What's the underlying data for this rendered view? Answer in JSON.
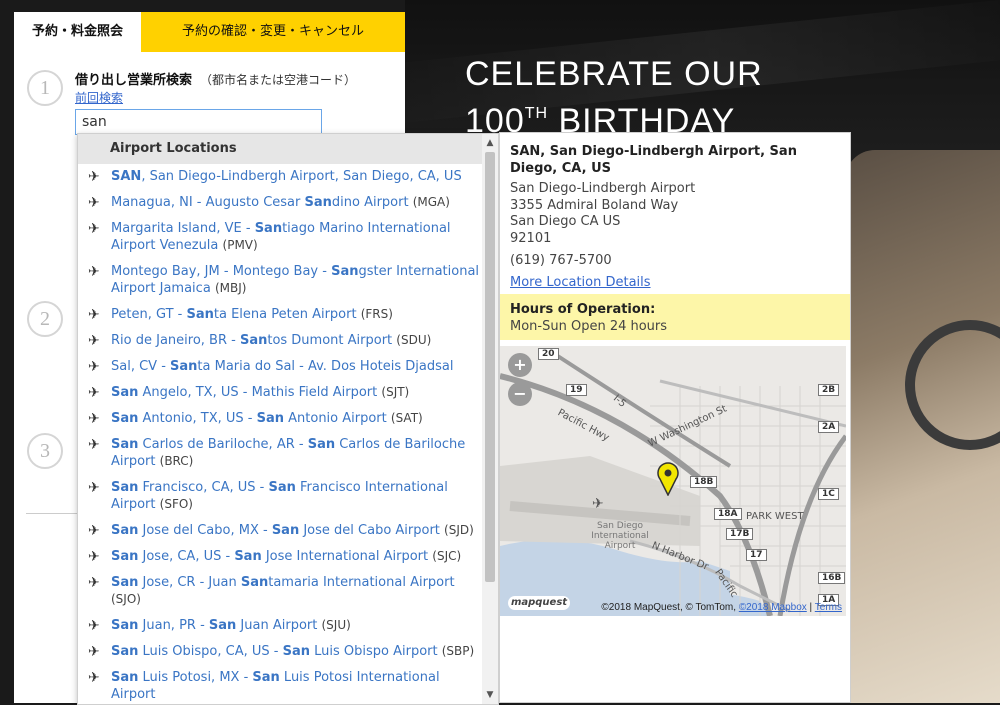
{
  "hero": {
    "line1": "CELEBRATE OUR",
    "line2_num": "100",
    "line2_sup": "TH",
    "line2_rest": " BIRTHDAY"
  },
  "tabs": {
    "active": "予約・料金照会",
    "inactive": "予約の確認・変更・キャンセル"
  },
  "steps": [
    "1",
    "2",
    "3"
  ],
  "pickup": {
    "label": "借り出し営業所検索",
    "hint": "（都市名または空港コード）",
    "prev_link": "前回検索",
    "input_value": "san"
  },
  "dropdown": {
    "header": "Airport Locations",
    "items": [
      {
        "pre": "",
        "hl1": "SAN",
        "mid": ", San Diego-Lindbergh Airport, San Diego, CA, US",
        "hl2": "",
        "post": "",
        "code": ""
      },
      {
        "pre": "Managua, NI - Augusto Cesar ",
        "hl1": "San",
        "mid": "dino Airport",
        "hl2": "",
        "post": "",
        "code": "(MGA)"
      },
      {
        "pre": "Margarita Island, VE - ",
        "hl1": "San",
        "mid": "tiago Marino International Airport Venezula",
        "hl2": "",
        "post": "",
        "code": "(PMV)"
      },
      {
        "pre": "Montego Bay, JM - Montego Bay - ",
        "hl1": "San",
        "mid": "gster International Airport Jamaica",
        "hl2": "",
        "post": "",
        "code": "(MBJ)"
      },
      {
        "pre": "Peten, GT - ",
        "hl1": "San",
        "mid": "ta Elena Peten Airport",
        "hl2": "",
        "post": "",
        "code": "(FRS)"
      },
      {
        "pre": "Rio de Janeiro, BR - ",
        "hl1": "San",
        "mid": "tos Dumont Airport",
        "hl2": "",
        "post": "",
        "code": "(SDU)"
      },
      {
        "pre": "Sal, CV - ",
        "hl1": "San",
        "mid": "ta Maria do Sal - Av. Dos Hoteis Djadsal",
        "hl2": "",
        "post": "",
        "code": ""
      },
      {
        "pre": "",
        "hl1": "San",
        "mid": " Angelo, TX, US - Mathis Field Airport",
        "hl2": "",
        "post": "",
        "code": "(SJT)"
      },
      {
        "pre": "",
        "hl1": "San",
        "mid": " Antonio, TX, US - ",
        "hl2": "San",
        "post": " Antonio Airport",
        "code": "(SAT)"
      },
      {
        "pre": "",
        "hl1": "San",
        "mid": " Carlos de Bariloche, AR - ",
        "hl2": "San",
        "post": " Carlos de Bariloche Airport",
        "code": "(BRC)"
      },
      {
        "pre": "",
        "hl1": "San",
        "mid": " Francisco, CA, US - ",
        "hl2": "San",
        "post": " Francisco International Airport",
        "code": "(SFO)"
      },
      {
        "pre": "",
        "hl1": "San",
        "mid": " Jose del Cabo, MX - ",
        "hl2": "San",
        "post": " Jose del Cabo Airport",
        "code": "(SJD)"
      },
      {
        "pre": "",
        "hl1": "San",
        "mid": " Jose, CA, US - ",
        "hl2": "San",
        "post": " Jose International Airport",
        "code": "(SJC)"
      },
      {
        "pre": "",
        "hl1": "San",
        "mid": " Jose, CR - Juan ",
        "hl2": "San",
        "post": "tamaria International Airport",
        "code": "(SJO)"
      },
      {
        "pre": "",
        "hl1": "San",
        "mid": " Juan, PR - ",
        "hl2": "San",
        "post": " Juan Airport",
        "code": "(SJU)"
      },
      {
        "pre": "",
        "hl1": "San",
        "mid": " Luis Obispo, CA, US - ",
        "hl2": "San",
        "post": " Luis Obispo Airport",
        "code": "(SBP)"
      },
      {
        "pre": "",
        "hl1": "San",
        "mid": " Luis Potosi, MX - ",
        "hl2": "San",
        "post": " Luis Potosi International Airport",
        "code": ""
      }
    ]
  },
  "detail": {
    "title": "SAN, San Diego-Lindbergh Airport, San Diego, CA, US",
    "address_lines": [
      "San Diego-Lindbergh Airport",
      "3355 Admiral Boland Way",
      "San Diego CA US",
      "92101"
    ],
    "phone": "(619) 767-5700",
    "more_link": "More Location Details",
    "hours_title": "Hours of Operation:",
    "hours_text": "Mon-Sun Open 24 hours"
  },
  "map": {
    "zoom_in": "+",
    "zoom_out": "−",
    "logo": "mapquest",
    "credit_text": "©2018 MapQuest, © TomTom, ",
    "credit_link1": "©2018 Mapbox",
    "credit_sep": " | ",
    "credit_link2": "Terms",
    "labels": {
      "pacific_hwy": "Pacific Hwy",
      "w_washington": "W Washington St",
      "i5": "I-5",
      "park_west": "PARK WEST",
      "airport": "San Diego International Airport",
      "n_harbor": "N Harbor Dr",
      "pacific": "Pacific"
    },
    "exits": [
      "20",
      "19",
      "2B",
      "2A",
      "18B",
      "1C",
      "18A",
      "17B",
      "17",
      "16B",
      "1A"
    ]
  },
  "colors": {
    "accent_yellow": "#ffd100",
    "link_blue": "#3366cc",
    "hours_bg": "#fdf6a8"
  }
}
